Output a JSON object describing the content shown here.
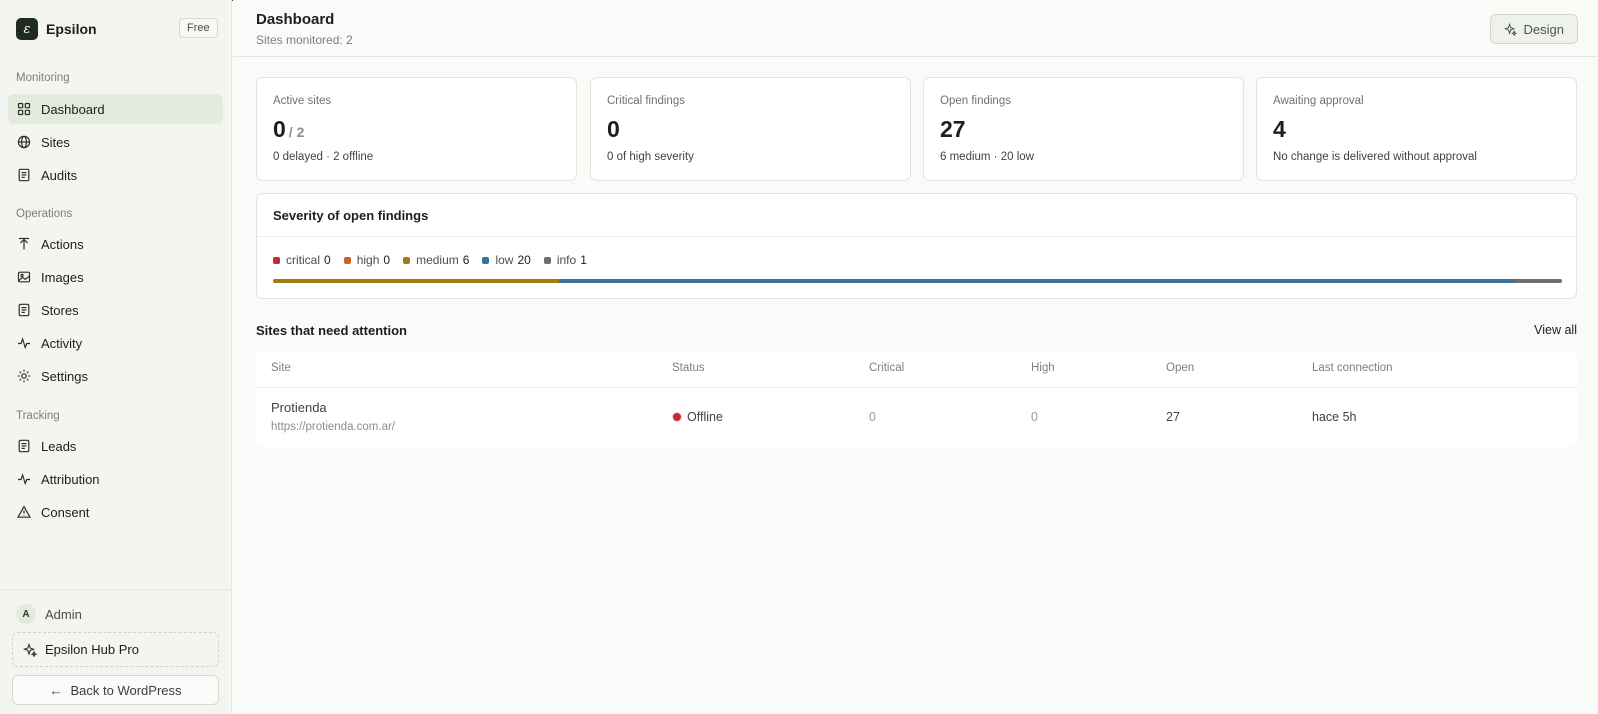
{
  "brand": {
    "name": "Epsilon",
    "logo_letter": "ε",
    "plan": "Free"
  },
  "sidebar": {
    "sections": [
      {
        "label": "Monitoring"
      },
      {
        "label": "Operations"
      },
      {
        "label": "Tracking"
      }
    ],
    "items": [
      {
        "label": "Dashboard",
        "icon": "grid-icon",
        "active": true
      },
      {
        "label": "Sites",
        "icon": "globe-icon"
      },
      {
        "label": "Audits",
        "icon": "document-icon"
      },
      {
        "label": "Actions",
        "icon": "upload-arrow-icon"
      },
      {
        "label": "Images",
        "icon": "image-icon"
      },
      {
        "label": "Stores",
        "icon": "document-icon"
      },
      {
        "label": "Activity",
        "icon": "pulse-icon"
      },
      {
        "label": "Settings",
        "icon": "gear-icon"
      },
      {
        "label": "Leads",
        "icon": "document-icon"
      },
      {
        "label": "Attribution",
        "icon": "pulse-icon"
      },
      {
        "label": "Consent",
        "icon": "warning-icon"
      }
    ],
    "user": {
      "initial": "A",
      "name": "Admin"
    },
    "pro_label": "Epsilon Hub Pro",
    "back_label": "Back to WordPress"
  },
  "header": {
    "title": "Dashboard",
    "subtitle": "Sites monitored: 2",
    "design_label": "Design"
  },
  "stats": [
    {
      "label": "Active sites",
      "value": "0",
      "denominator": "/ 2",
      "sub": "0 delayed · 2 offline"
    },
    {
      "label": "Critical findings",
      "value": "0",
      "sub": "0 of high severity"
    },
    {
      "label": "Open findings",
      "value": "27",
      "sub": "6 medium · 20 low"
    },
    {
      "label": "Awaiting approval",
      "value": "4",
      "sub": "No change is delivered without approval"
    }
  ],
  "severity": {
    "title": "Severity of open findings",
    "levels": [
      {
        "name": "critical",
        "count": "0",
        "value": 0,
        "color": "#c52b35"
      },
      {
        "name": "high",
        "count": "0",
        "value": 0,
        "color": "#c8642a"
      },
      {
        "name": "medium",
        "count": "6",
        "value": 6,
        "color": "#a37c14"
      },
      {
        "name": "low",
        "count": "20",
        "value": 20,
        "color": "#3a7399"
      },
      {
        "name": "info",
        "count": "1",
        "value": 1,
        "color": "#6b706b"
      }
    ]
  },
  "attention": {
    "title": "Sites that need attention",
    "view_all": "View all",
    "columns": [
      "Site",
      "Status",
      "Critical",
      "High",
      "Open",
      "Last connection"
    ],
    "rows": [
      {
        "name": "Protienda",
        "url": "https://protienda.com.ar/",
        "status": "Offline",
        "status_color": "#c52b35",
        "critical": "0",
        "high": "0",
        "open": "27",
        "last_connection": "hace 5h"
      }
    ]
  }
}
